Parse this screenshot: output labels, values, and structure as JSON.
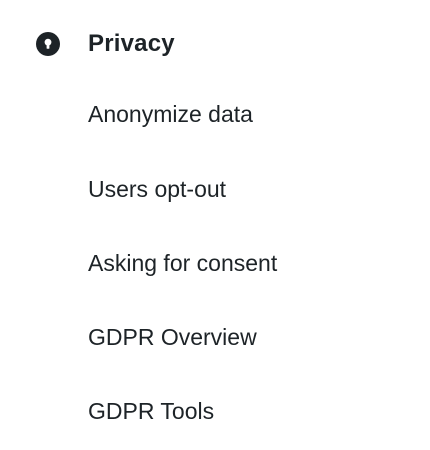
{
  "section": {
    "title": "Privacy",
    "icon": "lock-icon"
  },
  "items": [
    {
      "label": "Anonymize data"
    },
    {
      "label": "Users opt-out"
    },
    {
      "label": "Asking for consent"
    },
    {
      "label": "GDPR Overview"
    },
    {
      "label": "GDPR Tools"
    }
  ]
}
